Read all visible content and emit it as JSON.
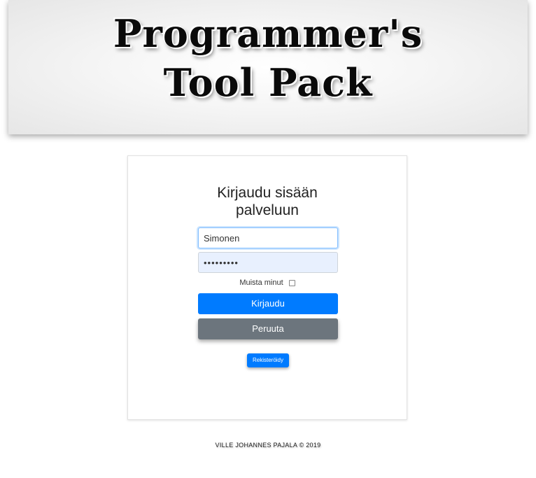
{
  "header": {
    "logo_line1": "Programmer's",
    "logo_line2": "Tool Pack"
  },
  "login": {
    "title_line1": "Kirjaudu sisään",
    "title_line2": "palveluun",
    "username_value": "Simonen",
    "password_value": "•••••••••",
    "remember_label": "Muista minut",
    "remember_checked": false,
    "login_button": "Kirjaudu",
    "cancel_button": "Peruuta",
    "register_button": "Rekisteröidy"
  },
  "footer": {
    "text": "VILLE JOHANNES PAJALA © 2019"
  },
  "colors": {
    "primary": "#007bff",
    "secondary": "#6c757d",
    "autofill": "#e8f0fe"
  }
}
